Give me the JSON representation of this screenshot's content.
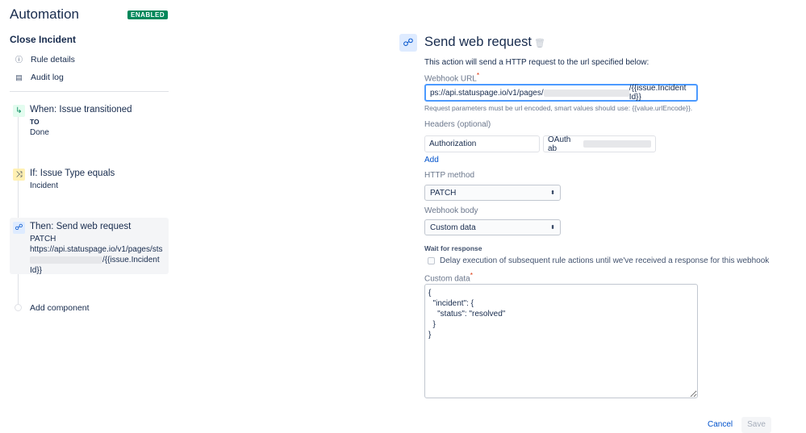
{
  "header": {
    "title": "Automation",
    "status": "ENABLED"
  },
  "rule": {
    "name": "Close Incident",
    "nav": [
      {
        "icon": "info-icon",
        "label": "Rule details"
      },
      {
        "icon": "document-icon",
        "label": "Audit log"
      }
    ]
  },
  "steps": [
    {
      "title": "When: Issue transitioned",
      "lines": [
        "TO",
        "Done"
      ]
    },
    {
      "title": "If: Issue Type equals",
      "lines": [
        "Incident"
      ]
    },
    {
      "title": "Then: Send web request",
      "lines": [
        "PATCH",
        "https://api.statuspage.io/v1/pages/sts",
        "/{{issue.Incident",
        "Id}}"
      ]
    }
  ],
  "add_component": "Add component",
  "panel": {
    "title": "Send web request",
    "description": "This action will send a HTTP request to the url specified below:",
    "webhook_url_label": "Webhook URL",
    "webhook_url_prefix": "ps://api.statuspage.io/v1/pages/",
    "webhook_url_suffix": "/{{issue.Incident Id}}",
    "url_help": "Request parameters must be url encoded, smart values should use: {{value.urlEncode}}.",
    "headers_label": "Headers (optional)",
    "header_name": "Authorization",
    "header_value": "OAuth ab",
    "add": "Add",
    "method_label": "HTTP method",
    "method": "PATCH",
    "body_label": "Webhook body",
    "body": "Custom data",
    "wait_label": "Wait for response",
    "wait_checkbox": "Delay execution of subsequent rule actions until we've received a response for this webhook",
    "custom_label": "Custom data",
    "custom_data": "{\n  \"incident\": {\n    \"status\": \"resolved\"\n  }\n}",
    "cancel": "Cancel",
    "save": "Save"
  }
}
